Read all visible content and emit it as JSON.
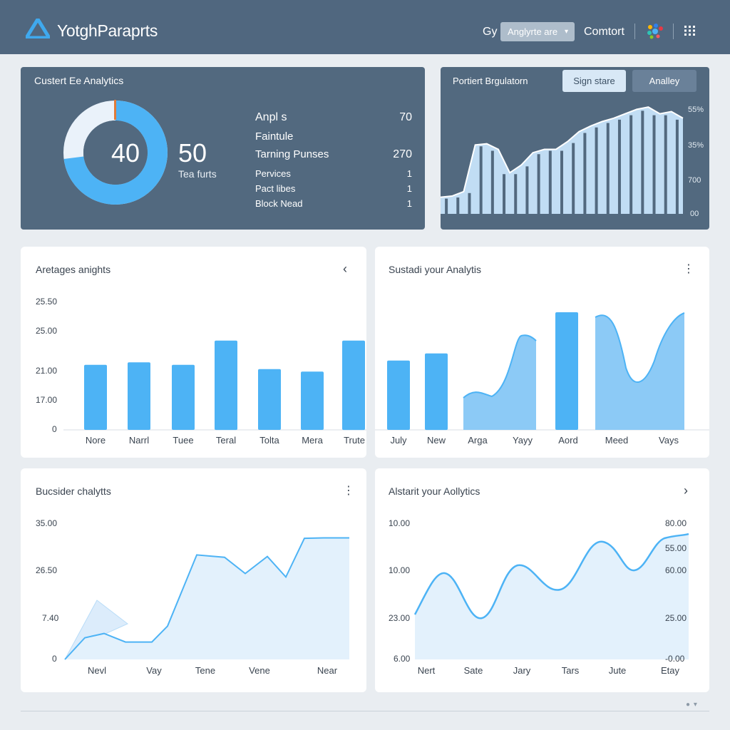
{
  "header": {
    "app_title": "YotghParaprts",
    "gy_label": "Gy",
    "select_value": "Anglyrte are",
    "contort_label": "Comtort"
  },
  "card1": {
    "title": "Custert Ee Analytics",
    "donut_center": "40",
    "donut_fraction": 0.73,
    "big_number": "50",
    "big_label": "Tea furts",
    "stats": [
      {
        "label": "Anpl s",
        "value": "70"
      },
      {
        "label": "Faintule",
        "value": ""
      },
      {
        "label": "Tarning Punses",
        "value": "270"
      },
      {
        "label": "Pervices",
        "value": "1"
      },
      {
        "label": "Pact libes",
        "value": "1"
      },
      {
        "label": "Block Nead",
        "value": "1"
      }
    ]
  },
  "card2": {
    "title": "Portiert Brgulatorn",
    "button_sign": "Sign stare",
    "button_analley": "Analley",
    "y_ticks": [
      "55%",
      "35%",
      "700",
      "00"
    ]
  },
  "card3": {
    "title": "Aretages anights",
    "nav_icon": "chevron-left-icon",
    "y_ticks": [
      "25.50",
      "25.00",
      "21.00",
      "17.00",
      "0"
    ],
    "x_labels": [
      "Nore",
      "Narrl",
      "Tuee",
      "Teral",
      "Tolta",
      "Mera",
      "Trute"
    ]
  },
  "card4": {
    "title": "Sustadi your Analytis",
    "nav_icon": "more-vertical-icon",
    "x_labels": [
      "July",
      "New",
      "Arga",
      "Yayy",
      "Aord",
      "Meed",
      "Vays"
    ]
  },
  "card5": {
    "title": "Bucsider chalytts",
    "nav_icon": "more-vertical-icon",
    "y_ticks": [
      "35.00",
      "26.50",
      "7.40",
      "0"
    ],
    "x_labels": [
      "Nevl",
      "Vay",
      "Tene",
      "Vene",
      "Near"
    ]
  },
  "card6": {
    "title": "Alstarit your Aollytics",
    "nav_icon": "chevron-right-icon",
    "y_ticks_left": [
      "10.00",
      "10.00",
      "23.00",
      "6.00"
    ],
    "y_ticks_right": [
      "80.00",
      "55.00",
      "60.00",
      "25.00",
      "-0.00"
    ],
    "x_labels": [
      "Nert",
      "Sate",
      "Jary",
      "Tars",
      "Jute",
      "Etay"
    ]
  },
  "colors": {
    "topbar": "#50677f",
    "dark_card": "#52697f",
    "accent_blue": "#4db3f5",
    "light_blue": "#bfe0fb",
    "area_fill": "#e3f1fc",
    "background": "#e9edf1"
  },
  "chart_data": [
    {
      "type": "bar",
      "chart": "card3",
      "categories": [
        "Nore",
        "Narrl",
        "Tuee",
        "Teral",
        "Tolta",
        "Mera",
        "Trute"
      ],
      "values": [
        21.1,
        21.4,
        21.1,
        24.0,
        20.6,
        20.3,
        24.0
      ]
    },
    {
      "type": "bar",
      "chart": "card4",
      "categories": [
        "July",
        "New",
        "Aord"
      ],
      "values": [
        0.59,
        0.65,
        1.0
      ]
    },
    {
      "type": "line",
      "chart": "card5",
      "x": [
        "Nevl",
        "Vay",
        "Tene",
        "Vene",
        "Near"
      ],
      "values": [
        0,
        5.6,
        6.7,
        4.5,
        4.5,
        8.6,
        27.0,
        26.4,
        22.2,
        26.6,
        21.3,
        31.3,
        31.4
      ],
      "ylim": [
        0,
        35
      ]
    },
    {
      "type": "area",
      "chart": "card2",
      "values": [
        0.15,
        0.16,
        0.2,
        0.62,
        0.63,
        0.58,
        0.37,
        0.44,
        0.55,
        0.58,
        0.58,
        0.65,
        0.74,
        0.79,
        0.83,
        0.86,
        0.9,
        0.94,
        0.96,
        0.9,
        0.92,
        0.86
      ]
    }
  ]
}
